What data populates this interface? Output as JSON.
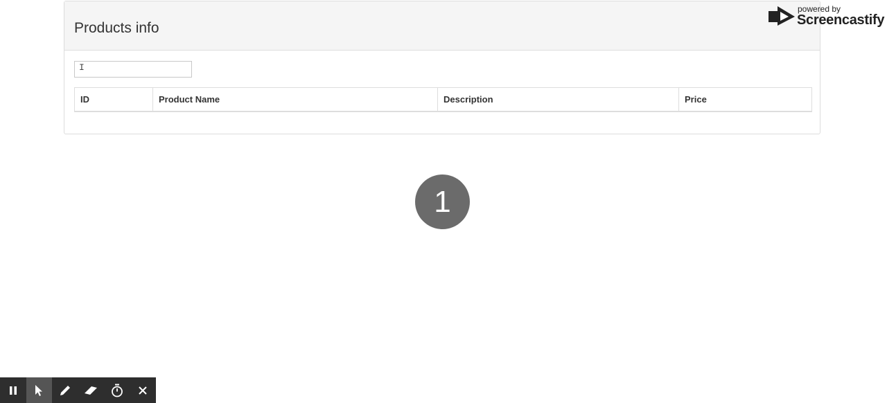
{
  "panel": {
    "title": "Products info",
    "search": {
      "value": "",
      "placeholder": ""
    }
  },
  "table": {
    "columns": [
      "ID",
      "Product Name",
      "Description",
      "Price"
    ],
    "rows": []
  },
  "overlay": {
    "countdown": "1",
    "watermark": {
      "powered": "powered by",
      "brand": "Screencastify"
    }
  },
  "toolbar": {
    "buttons": [
      {
        "name": "pause-icon",
        "active": false
      },
      {
        "name": "cursor-icon",
        "active": true
      },
      {
        "name": "pen-icon",
        "active": false
      },
      {
        "name": "eraser-icon",
        "active": false
      },
      {
        "name": "timer-icon",
        "active": false
      },
      {
        "name": "close-icon",
        "active": false
      }
    ]
  }
}
